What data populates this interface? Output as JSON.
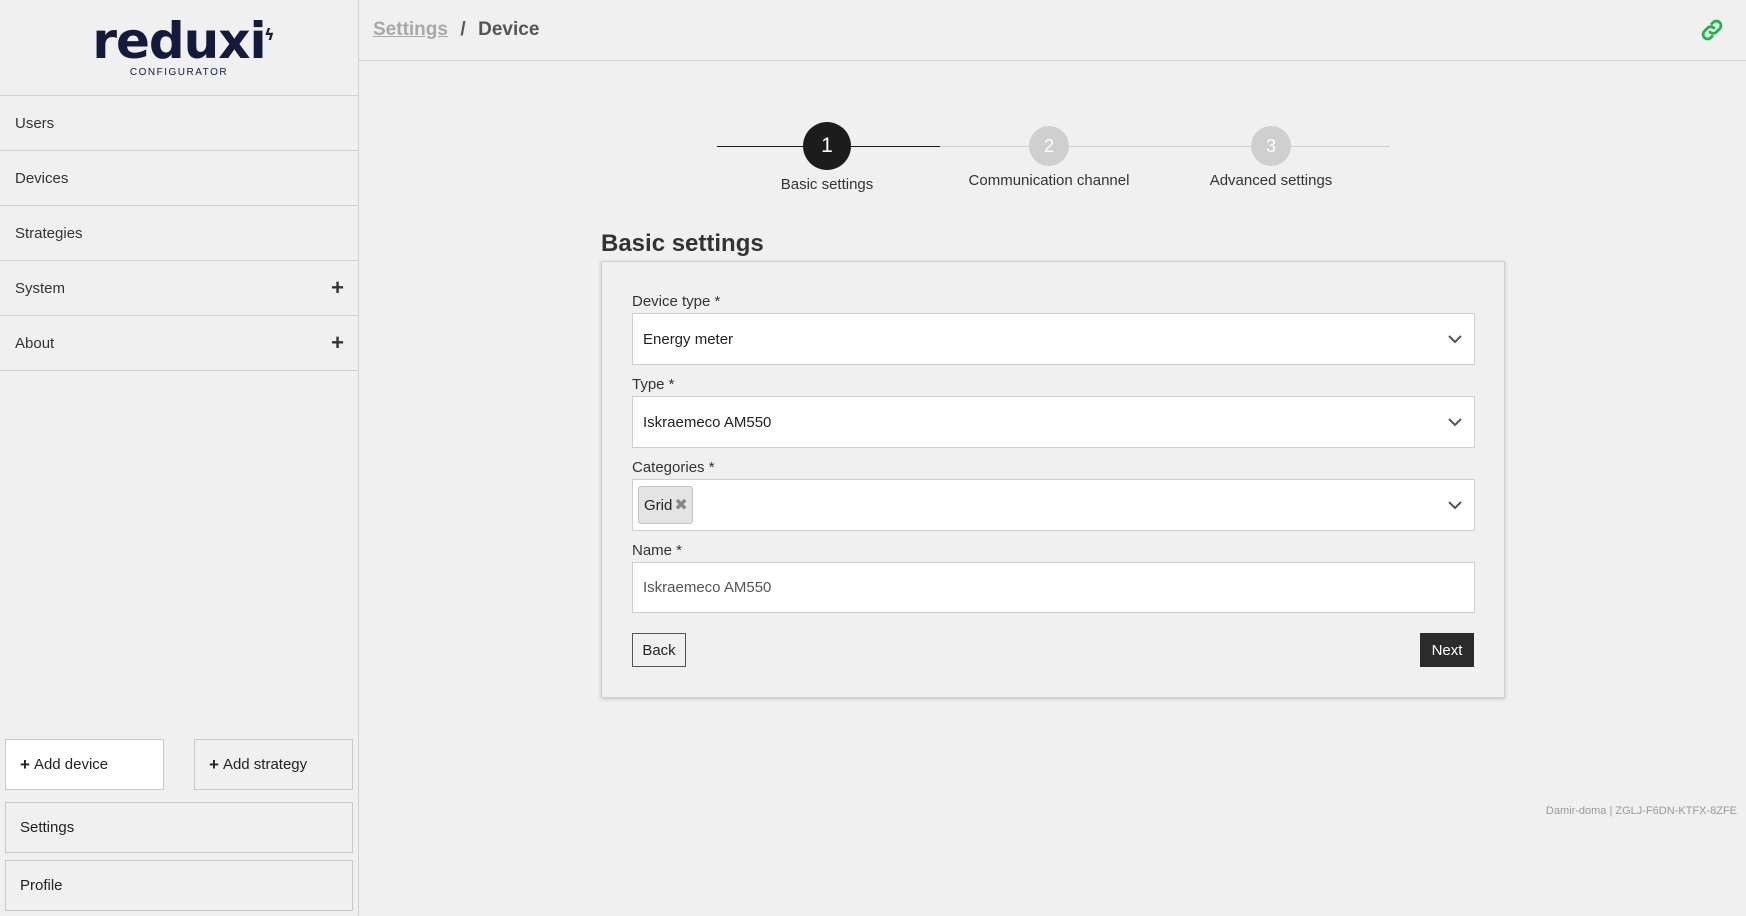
{
  "logo": {
    "word": "reduxi",
    "subtitle": "CONFIGURATOR"
  },
  "sidebar": {
    "items": [
      {
        "label": "Users",
        "expandable": false
      },
      {
        "label": "Devices",
        "expandable": false
      },
      {
        "label": "Strategies",
        "expandable": false
      },
      {
        "label": "System",
        "expandable": true
      },
      {
        "label": "About",
        "expandable": true
      }
    ],
    "add_device": "Add device",
    "add_strategy": "Add strategy",
    "settings": "Settings",
    "profile": "Profile"
  },
  "header": {
    "crumb_link": "Settings",
    "separator": "/",
    "current": "Device"
  },
  "stepper": {
    "steps": [
      {
        "number": "1",
        "label": "Basic settings",
        "active": true
      },
      {
        "number": "2",
        "label": "Communication channel",
        "active": false
      },
      {
        "number": "3",
        "label": "Advanced settings",
        "active": false
      }
    ]
  },
  "form": {
    "title": "Basic settings",
    "device_type": {
      "label": "Device type *",
      "value": "Energy meter"
    },
    "type": {
      "label": "Type *",
      "value": "Iskraemeco AM550"
    },
    "categories": {
      "label": "Categories *",
      "tags": [
        "Grid"
      ]
    },
    "name": {
      "label": "Name *",
      "value": "Iskraemeco AM550"
    },
    "back_label": "Back",
    "next_label": "Next"
  },
  "footer": {
    "info": "Damir-doma | ZGLJ-F6DN-KTFX-8ZFE"
  },
  "colors": {
    "accent_green": "#22b14c",
    "dark": "#1c1c1c",
    "logo_navy": "#141a3c"
  }
}
